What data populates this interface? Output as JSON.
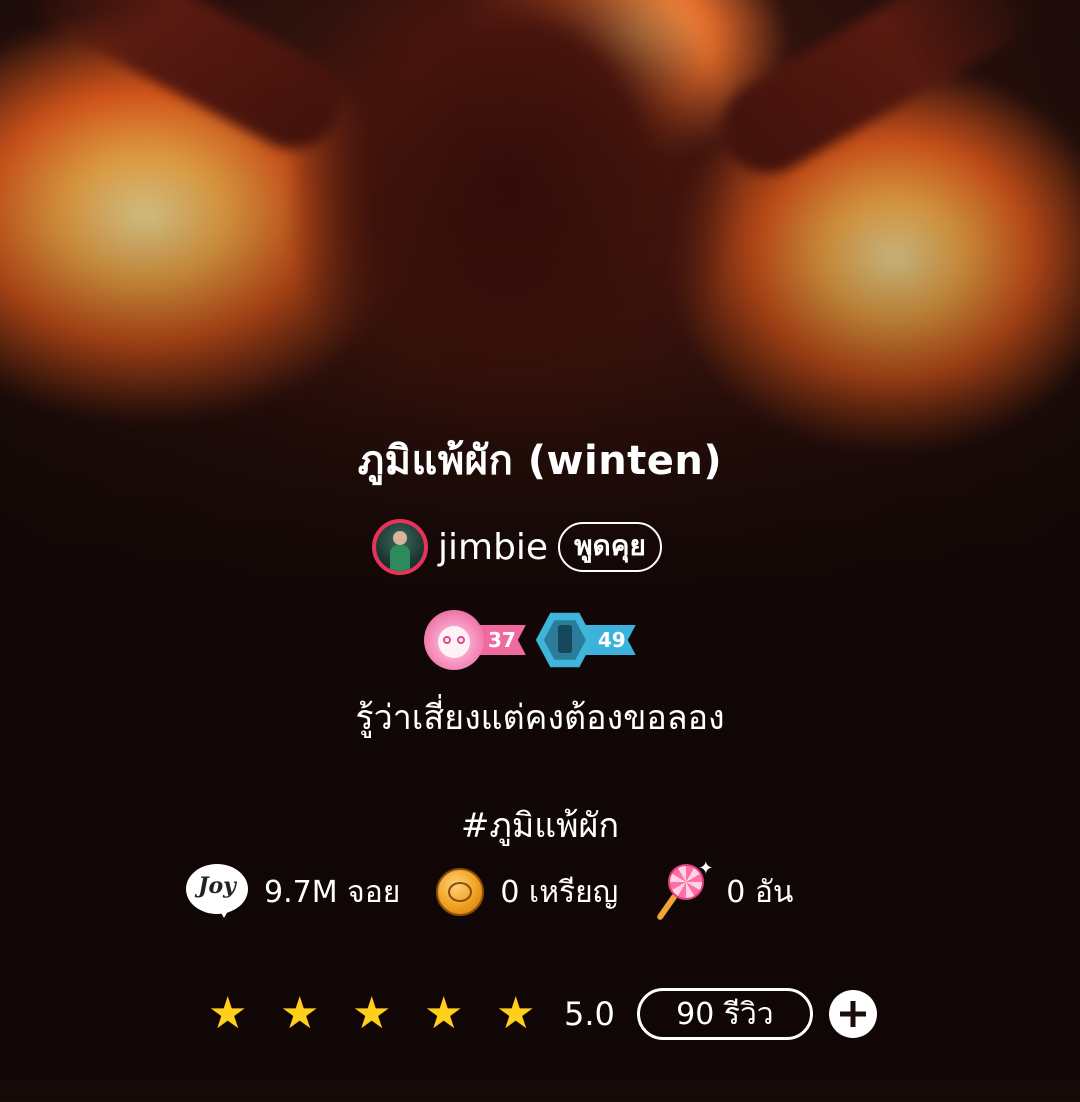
{
  "cover": {
    "icon": "blurred-cover-photo"
  },
  "story": {
    "title": "ภูมิแพ้ผัก (winten)",
    "author": {
      "name": "jimbie",
      "avatar_icon": "avatar-photo",
      "avatar_ring_color": "#e8325a",
      "talk_label": "พูดคุย"
    },
    "levels": [
      {
        "icon": "pink-ghost-badge-icon",
        "value": "37",
        "color": "#f06aa0"
      },
      {
        "icon": "blue-hexagon-badge-icon",
        "value": "49",
        "color": "#3bb3dd"
      }
    ],
    "description": "รู้ว่าเสี่ยงแต่คงต้องขอลอง",
    "hashtag": "#ภูมิแพ้ผัก"
  },
  "stats": {
    "joy": {
      "icon": "joy-icon",
      "icon_text": "Joy",
      "value": "9.7M จอย"
    },
    "coins": {
      "icon": "coin-icon",
      "value": "0 เหรียญ"
    },
    "lollipops": {
      "icon": "lollipop-icon",
      "value": "0 อัน"
    }
  },
  "rating": {
    "stars": 5,
    "star_color": "#ffcf1c",
    "score": "5.0",
    "reviews_label": "90 รีวิว",
    "add_icon": "plus-icon"
  }
}
